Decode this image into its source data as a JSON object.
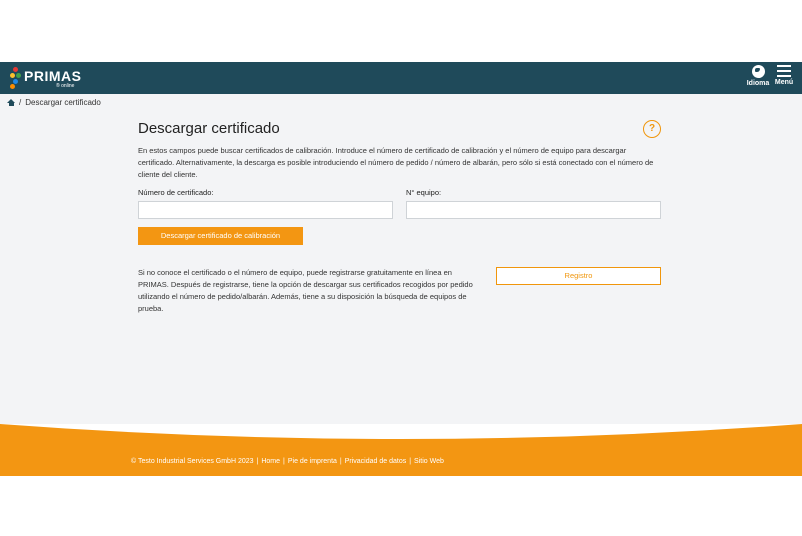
{
  "header": {
    "logo_text": "PRIMAS",
    "logo_sub": "® online",
    "language_label": "Idioma",
    "menu_label": "Menú"
  },
  "breadcrumb": {
    "current": "Descargar certificado",
    "separator": "/"
  },
  "page": {
    "title": "Descargar certificado",
    "help": "?",
    "intro": "En estos campos puede buscar certificados de calibración. Introduce el número de certificado de calibración y el número de equipo para descargar certificado. Alternativamente, la descarga es posible introduciendo el número de pedido / número de albarán, pero sólo si está conectado con el número de cliente del cliente."
  },
  "form": {
    "certificate_label": "Número de certificado:",
    "certificate_value": "",
    "equipment_label": "N° equipo:",
    "equipment_value": "",
    "download_button": "Descargar certificado de calibración"
  },
  "register": {
    "text": "Si no conoce el certificado o el número de equipo, puede registrarse gratuitamente en línea en PRIMAS. Después de registrarse, tiene la opción de descargar sus certificados recogidos por pedido utilizando el número de pedido/albarán. Además, tiene a su disposición la búsqueda de equipos de prueba.",
    "button": "Registro"
  },
  "footer": {
    "copyright": "© Testo Industrial Services GmbH 2023",
    "sep": "|",
    "links": [
      "Home",
      "Pie de imprenta",
      "Privacidad de datos",
      "Sitio Web"
    ]
  },
  "colors": {
    "header_bg": "#1f4a5a",
    "accent": "#f39612",
    "page_bg": "#f3f4f6"
  }
}
